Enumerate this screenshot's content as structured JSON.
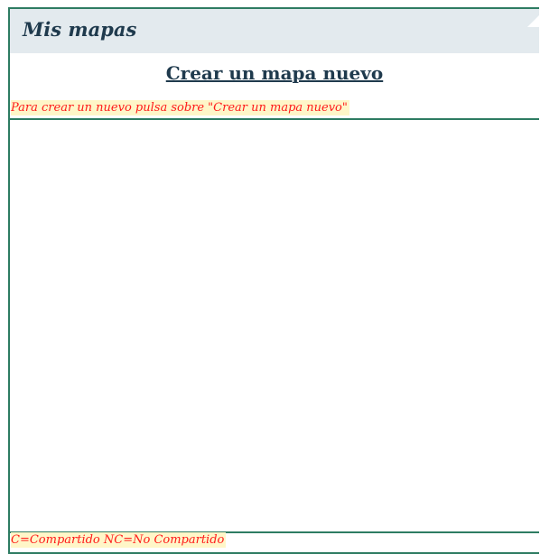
{
  "panel": {
    "title": "Mis mapas"
  },
  "actions": {
    "create_map_label": "Crear un mapa nuevo"
  },
  "messages": {
    "instructions": "Para crear un nuevo pulsa sobre \"Crear un mapa nuevo\"",
    "legend": "C=Compartido NC=No Compartido"
  },
  "colors": {
    "border": "#2e7c62",
    "header_bg": "#e3eaee",
    "title_text": "#1f3a4d",
    "note_text": "#ff1a1a",
    "note_bg": "#fff6c8"
  },
  "icons": {
    "header_corner": "corner-triangle-icon"
  }
}
